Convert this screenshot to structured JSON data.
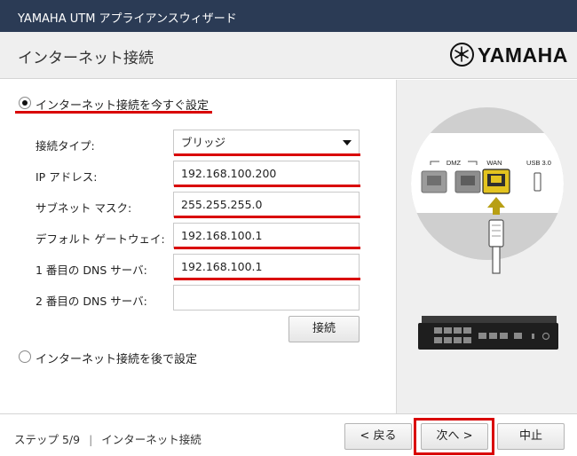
{
  "window": {
    "title": "YAMAHA UTM アプライアンスウィザード"
  },
  "header": {
    "title": "インターネット接続",
    "logo_text": "YAMAHA"
  },
  "options": {
    "now": {
      "label": "インターネット接続を今すぐ設定",
      "selected": true
    },
    "later": {
      "label": "インターネット接続を後で設定",
      "selected": false
    }
  },
  "form": {
    "connection_type": {
      "label": "接続タイプ:",
      "value": "ブリッジ"
    },
    "ip_address": {
      "label": "IP アドレス:",
      "value": "192.168.100.200"
    },
    "subnet_mask": {
      "label": "サブネット マスク:",
      "value": "255.255.255.0"
    },
    "default_gateway": {
      "label": "デフォルト ゲートウェイ:",
      "value": "192.168.100.1"
    },
    "dns1": {
      "label": "1 番目の DNS サーバ:",
      "value": "192.168.100.1"
    },
    "dns2": {
      "label": "2 番目の DNS サーバ:",
      "value": ""
    },
    "connect_button": "接続"
  },
  "illustration": {
    "port_labels": {
      "dmz": "DMZ",
      "wan": "WAN",
      "usb": "USB 3.0"
    }
  },
  "footer": {
    "step": "ステップ 5/9",
    "separator": "|",
    "step_name": "インターネット接続",
    "back": "< 戻る",
    "next": "次へ >",
    "cancel": "中止"
  },
  "colors": {
    "titlebar": "#2b3b55",
    "highlight": "#d90000",
    "wan_port": "#e3c31f",
    "cable_arrow": "#b89f14"
  }
}
